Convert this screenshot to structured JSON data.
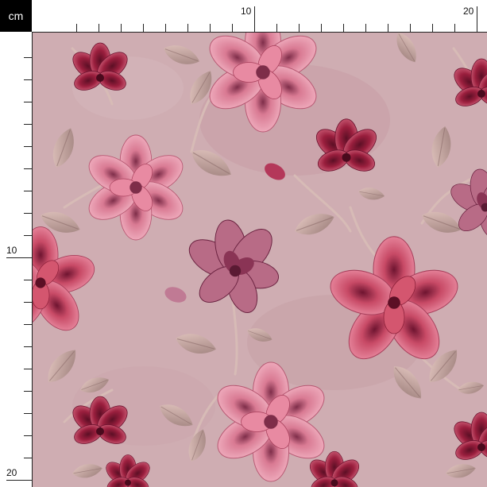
{
  "ruler": {
    "unit": "cm",
    "top_labels": [
      "10",
      "20"
    ],
    "left_labels": [
      "10",
      "20"
    ]
  },
  "pattern": {
    "name": "pink floral",
    "colors": {
      "background": "#cfadb2",
      "blush": "#f2a9bc",
      "rose": "#c84a66",
      "crimson": "#9b1f3e",
      "plum": "#7e2d49",
      "leaf": "#c8aaa7",
      "leaf_dark": "#8c6d6a",
      "stem": "#d7bbb6"
    },
    "icons": [
      "flower-icon",
      "leaf-icon"
    ]
  }
}
